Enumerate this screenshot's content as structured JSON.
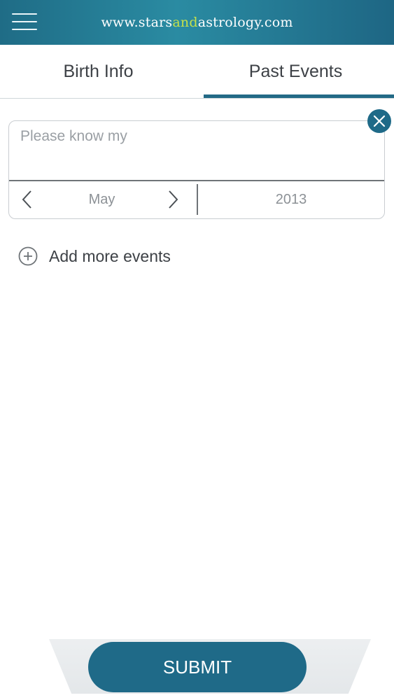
{
  "header": {
    "brand_prefix": "www.stars",
    "brand_accent": "and",
    "brand_suffix": "astrology.com",
    "menu_icon": "hamburger-menu-icon"
  },
  "tabs": [
    {
      "label": "Birth Info",
      "active": false
    },
    {
      "label": "Past Events",
      "active": true
    }
  ],
  "event": {
    "text_placeholder": "Please know my",
    "month": "May",
    "year": "2013",
    "prev_icon": "chevron-left-icon",
    "next_icon": "chevron-right-icon",
    "close_icon": "close-icon"
  },
  "add_more": {
    "label": "Add more events",
    "icon": "plus-circle-icon"
  },
  "submit": {
    "label": "SUBMIT"
  },
  "colors": {
    "primary": "#1f6a88",
    "brand_accent": "#c6e04a",
    "text": "#3d4146",
    "muted": "#8c9196"
  }
}
